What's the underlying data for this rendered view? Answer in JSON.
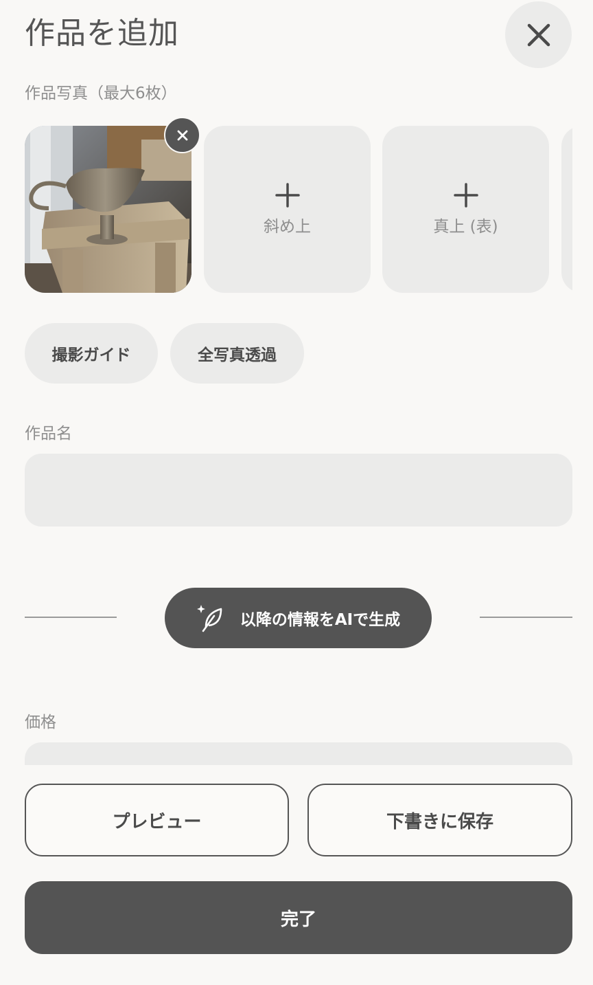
{
  "header": {
    "title": "作品を追加",
    "close_icon": "close-icon"
  },
  "photos": {
    "label": "作品写真（最大6枚）",
    "uploaded": [
      {
        "remove_icon": "close-icon",
        "subject": "photo of a metal gravy boat on a wooden stool"
      }
    ],
    "slots": [
      {
        "label": "斜め上",
        "icon": "plus-icon"
      },
      {
        "label": "真上 (表)",
        "icon": "plus-icon"
      }
    ]
  },
  "photo_actions": {
    "guide_label": "撮影ガイド",
    "transparent_label": "全写真透過"
  },
  "title_field": {
    "label": "作品名",
    "value": "",
    "placeholder": ""
  },
  "ai": {
    "label": "以降の情報をAIで生成",
    "icon": "sparkle-feather-icon"
  },
  "price_field": {
    "label": "価格"
  },
  "footer": {
    "preview_label": "プレビュー",
    "save_draft_label": "下書きに保存",
    "done_label": "完了"
  },
  "colors": {
    "background": "#f9f8f6",
    "surface": "#ebebea",
    "primary": "#545454",
    "text": "#4a4a4a",
    "muted": "#8e8e8e"
  }
}
